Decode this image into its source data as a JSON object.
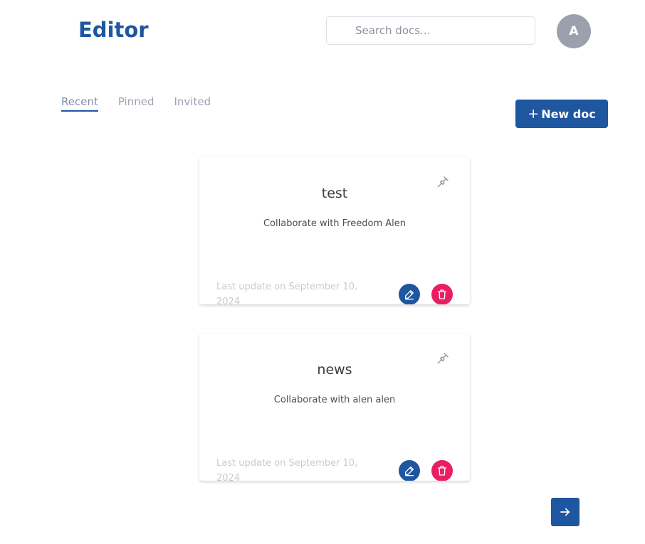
{
  "header": {
    "brand": "Editor",
    "search_placeholder": "Search docs...",
    "avatar_initial": "A"
  },
  "tabs": [
    {
      "label": "Recent",
      "active": true
    },
    {
      "label": "Pinned",
      "active": false
    },
    {
      "label": "Invited",
      "active": false
    }
  ],
  "new_doc": {
    "plus": "+",
    "label": "New doc"
  },
  "documents": [
    {
      "title": "test",
      "subtitle": "Collaborate with Freedom Alen",
      "updated": "Last update on September 10, 2024"
    },
    {
      "title": "news",
      "subtitle": "Collaborate with alen alen",
      "updated": "Last update on September 10, 2024"
    }
  ],
  "icons": {
    "pin": "pin-icon",
    "edit": "pencil-icon",
    "delete": "trash-icon",
    "next": "arrow-right-icon"
  },
  "colors": {
    "primary": "#1e56a0",
    "danger": "#e91e63",
    "avatar_bg": "#9aa1ad",
    "muted_text": "#c8cbd0",
    "tab_text": "#9ba3b0"
  }
}
